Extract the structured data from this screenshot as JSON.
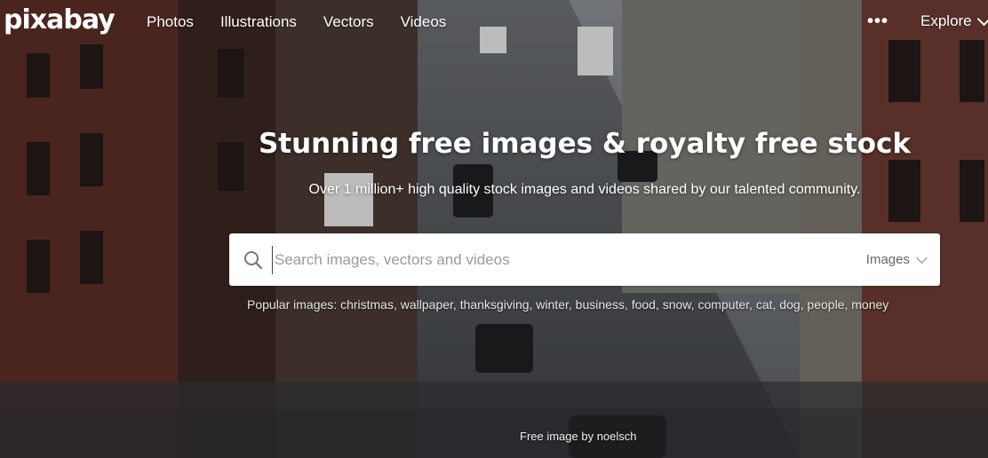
{
  "topbar": {
    "logo": "pixabay",
    "nav": [
      "Photos",
      "Illustrations",
      "Vectors",
      "Videos"
    ],
    "more": "•••",
    "explore": "Explore"
  },
  "hero": {
    "headline": "Stunning free images & royalty free stock",
    "subline": "Over 1 million+ high quality stock images and videos shared by our talented community."
  },
  "search": {
    "placeholder": "Search images, vectors and videos",
    "value": "",
    "type": "Images"
  },
  "popular": {
    "label": "Popular images:",
    "tags": [
      "christmas",
      "wallpaper",
      "thanksgiving",
      "winter",
      "business",
      "food",
      "snow",
      "computer",
      "cat",
      "dog",
      "people",
      "money"
    ]
  },
  "credit": "Free image by noelsch",
  "colors": {
    "search_bg": "#ffffff",
    "text_white": "#ffffff",
    "placeholder": "#9a9a9a"
  }
}
